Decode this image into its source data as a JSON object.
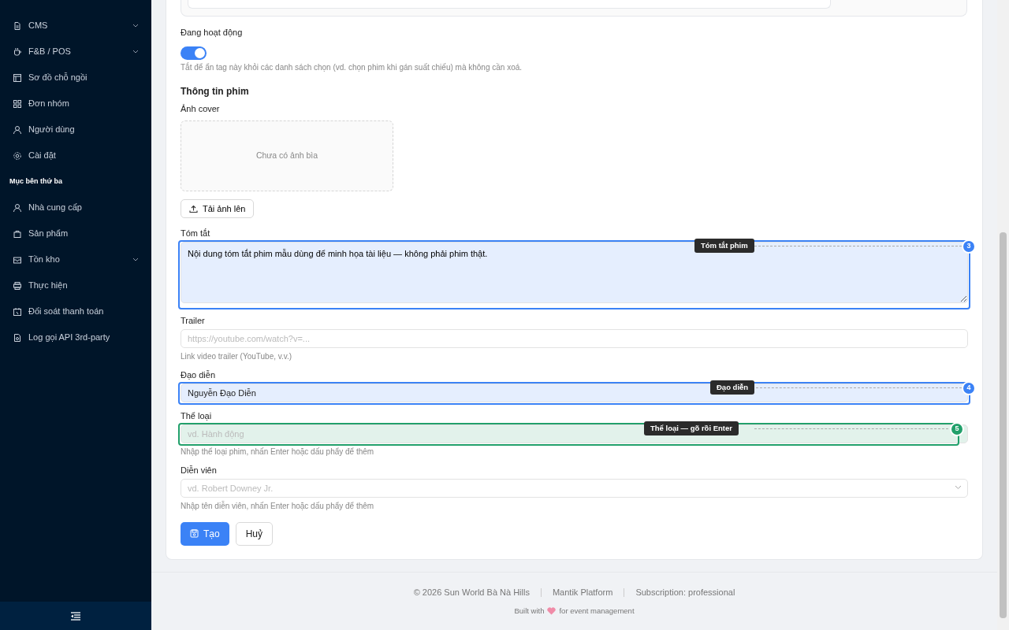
{
  "sidebar": {
    "items": [
      {
        "label": "CMS",
        "expandable": true
      },
      {
        "label": "F&B / POS",
        "expandable": true
      },
      {
        "label": "Sơ đồ chỗ ngồi",
        "expandable": false
      },
      {
        "label": "Đơn nhóm",
        "expandable": false
      },
      {
        "label": "Người dùng",
        "expandable": false
      },
      {
        "label": "Cài đặt",
        "expandable": false
      },
      {
        "kind": "header",
        "label": "Mục bên thứ ba"
      },
      {
        "label": "Nhà cung cấp",
        "expandable": false
      },
      {
        "label": "Sản phẩm",
        "expandable": false
      },
      {
        "label": "Tồn kho",
        "expandable": true
      },
      {
        "label": "Thực hiện",
        "expandable": false
      },
      {
        "label": "Đối soát thanh toán",
        "expandable": false
      },
      {
        "label": "Log gọi API 3rd-party",
        "expandable": false
      }
    ]
  },
  "form": {
    "active": {
      "label": "Đang hoạt động",
      "on": true,
      "help": "Tắt để ẩn tag này khỏi các danh sách chọn (vd. chọn phim khi gán suất chiếu) mà không cần xoá."
    },
    "section_title": "Thông tin phim",
    "cover": {
      "label": "Ảnh cover",
      "empty_text": "Chưa có ảnh bìa",
      "upload_button": "Tải ảnh lên"
    },
    "fields": [
      {
        "kind": "textarea",
        "label": "Tóm tắt",
        "value": "Nội dung tóm tắt phim mẫu dùng để minh họa tài liệu — không phải phim thật.",
        "annotation": {
          "label": "Tóm tắt phim",
          "number": "3",
          "color": "#3b82f6"
        }
      },
      {
        "kind": "input",
        "label": "Trailer",
        "placeholder": "https://youtube.com/watch?v=...",
        "help": "Link video trailer (YouTube, v.v.)"
      },
      {
        "kind": "input",
        "label": "Đạo diễn",
        "value": "Nguyễn Đạo Diễn",
        "annotation": {
          "label": "Đạo diễn",
          "number": "4",
          "color": "#3b82f6"
        }
      },
      {
        "kind": "input",
        "label": "Thể loại",
        "placeholder": "vd. Hành động",
        "help": "Nhập thể loại phim, nhấn Enter hoặc dấu phẩy để thêm",
        "annotation": {
          "label": "Thể loại — gõ rồi Enter",
          "number": "5",
          "color": "#22a06b"
        }
      },
      {
        "kind": "select",
        "label": "Diễn viên",
        "placeholder": "vd. Robert Downey Jr.",
        "help": "Nhập tên diễn viên, nhấn Enter hoặc dấu phẩy để thêm"
      }
    ],
    "buttons": [
      {
        "kind": "primary",
        "label": "Tạo"
      },
      {
        "kind": "default",
        "label": "Huỷ"
      }
    ]
  },
  "footer": {
    "items": [
      "© 2026 Sun World Bà Nà Hills",
      "Mantik Platform",
      "Subscription: professional"
    ],
    "built_with": [
      "Built with",
      "for event management"
    ]
  }
}
